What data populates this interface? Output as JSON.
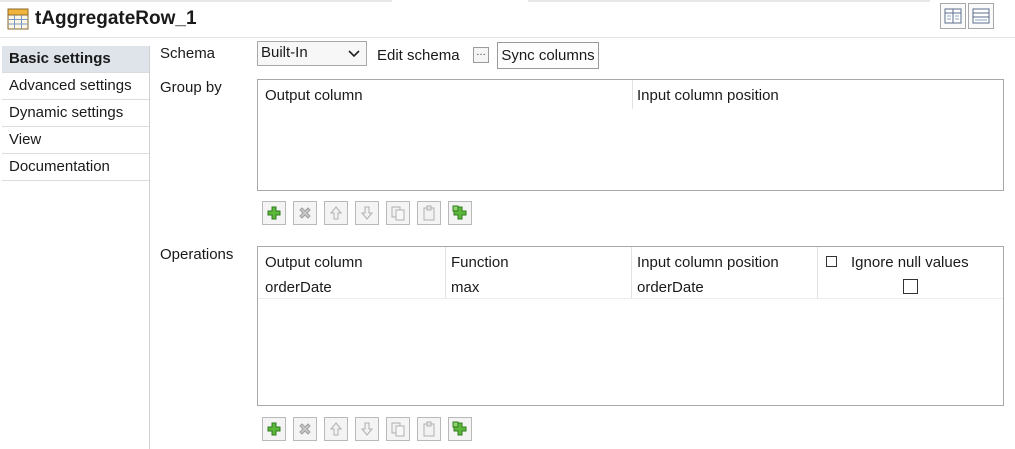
{
  "header": {
    "title": "tAggregateRow_1",
    "icon": "component-grid-icon"
  },
  "nav": {
    "items": [
      {
        "label": "Basic settings",
        "active": true
      },
      {
        "label": "Advanced settings",
        "active": false
      },
      {
        "label": "Dynamic settings",
        "active": false
      },
      {
        "label": "View",
        "active": false
      },
      {
        "label": "Documentation",
        "active": false
      }
    ]
  },
  "schema": {
    "label": "Schema",
    "selected": "Built-In",
    "edit_label": "Edit schema",
    "edit_button_label": "…",
    "sync_label": "Sync columns"
  },
  "group_by": {
    "label": "Group by",
    "columns": [
      "Output column",
      "Input column position"
    ],
    "rows": []
  },
  "operations": {
    "label": "Operations",
    "columns": [
      "Output column",
      "Function",
      "Input column position",
      "Ignore null values"
    ],
    "rows": [
      {
        "output_column": "orderDate",
        "function": "max",
        "input_column_position": "orderDate",
        "ignore_null": false
      }
    ]
  },
  "toolbar_icons": [
    "add-icon",
    "remove-icon",
    "move-up-icon",
    "move-down-icon",
    "copy-icon",
    "paste-icon",
    "duplicate-add-icon"
  ],
  "colors": {
    "nav_active_bg": "#dfe3ea",
    "add_green": "#3f9a2a",
    "border": "#a8a8a8"
  }
}
